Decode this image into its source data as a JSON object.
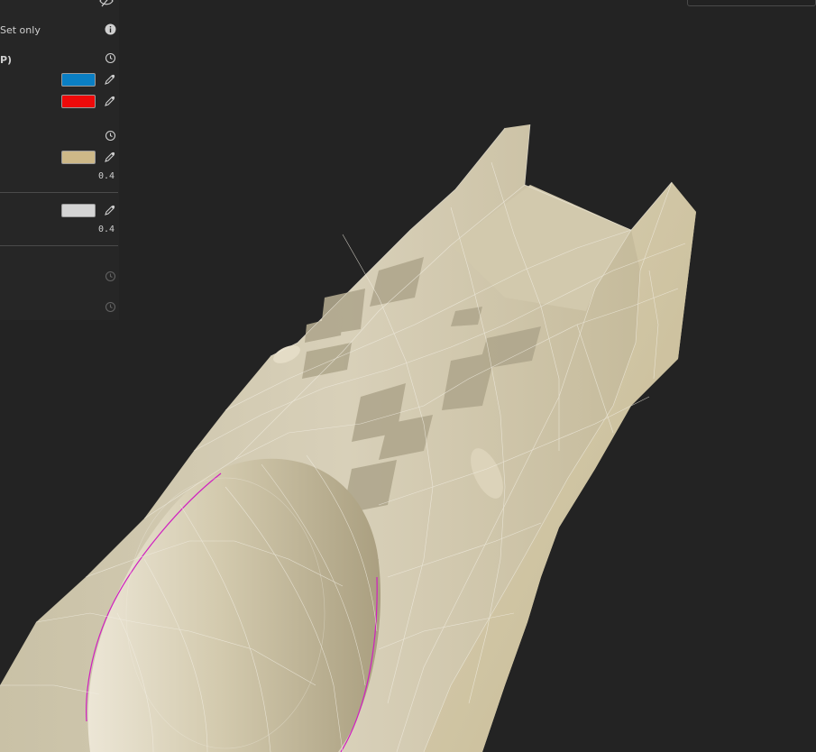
{
  "panel": {
    "selection_label": "Set only",
    "section_heading": "P)",
    "colors": {
      "blue": "#0A7FC4",
      "red": "#EE0A0A",
      "tan": "#CDB888",
      "light_gray": "#D4D4D4"
    },
    "tan_opacity": "0.4",
    "gray_opacity": "0.4"
  },
  "viewport": {
    "mesh_color": "#D6CDB4",
    "wire_color": "#F4F0E6",
    "seam_color": "#D01FC0",
    "background": "#232323"
  }
}
